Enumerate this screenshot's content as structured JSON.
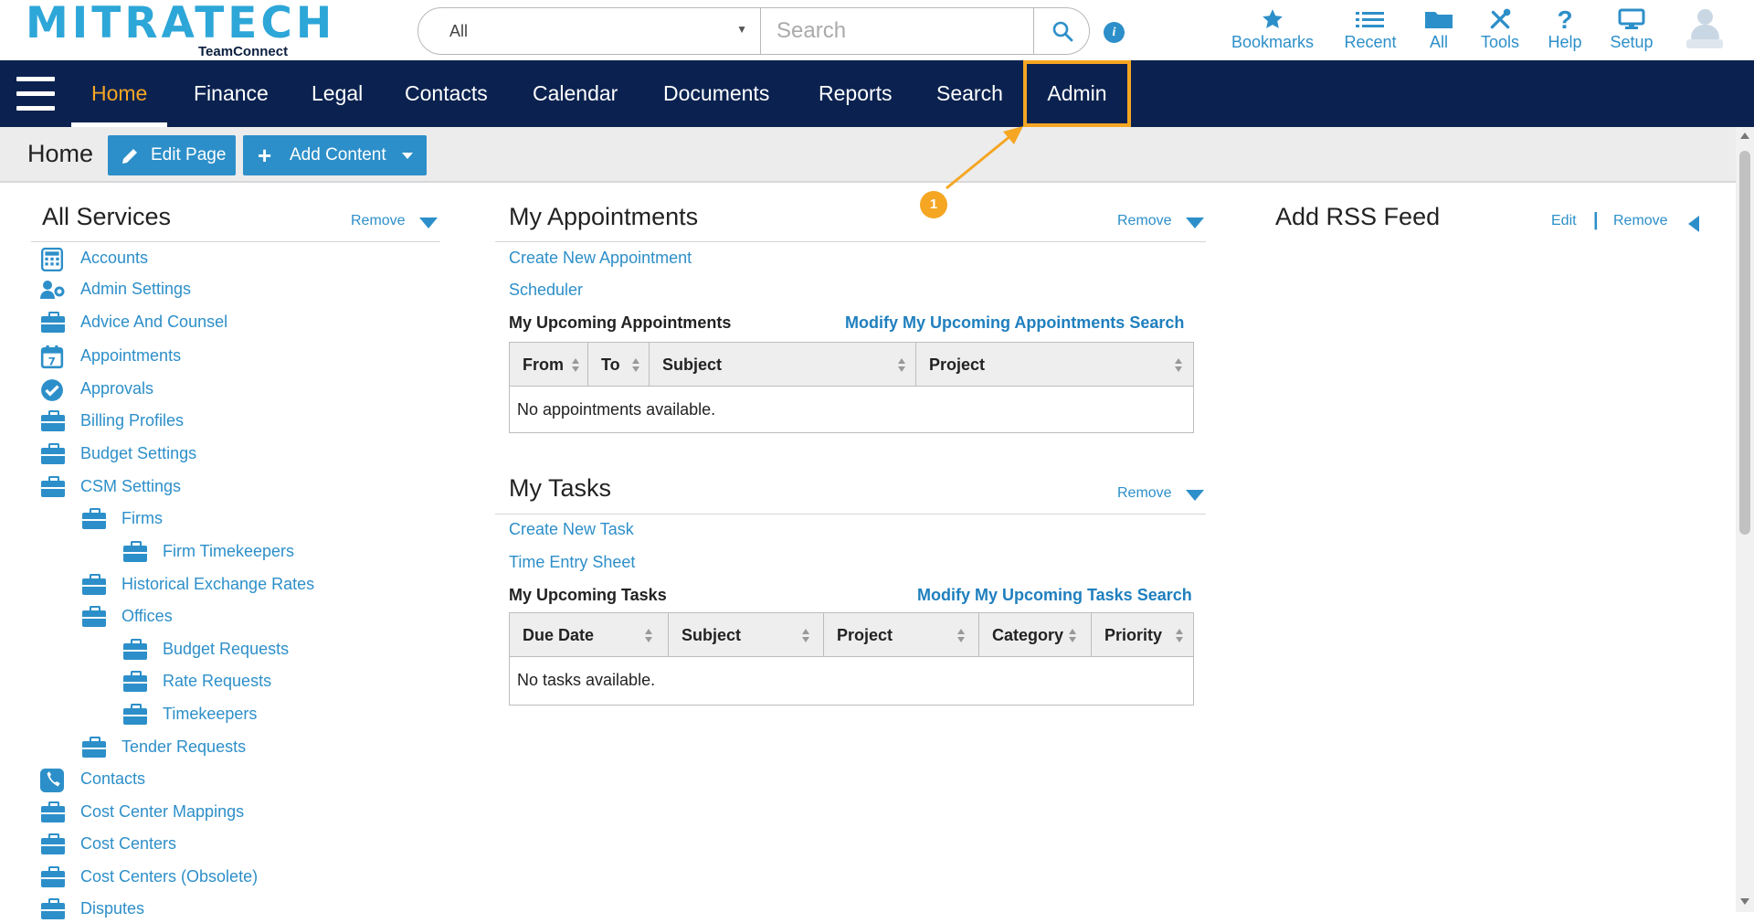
{
  "logo": {
    "main": "MITRATECH",
    "sub": "TeamConnect"
  },
  "search": {
    "scope": "All",
    "placeholder": "Search"
  },
  "toolbar": [
    {
      "label": "Bookmarks",
      "icon": "star-icon"
    },
    {
      "label": "Recent",
      "icon": "list-icon"
    },
    {
      "label": "All",
      "icon": "folder-icon"
    },
    {
      "label": "Tools",
      "icon": "tools-icon"
    },
    {
      "label": "Help",
      "icon": "help-icon"
    },
    {
      "label": "Setup",
      "icon": "monitor-icon"
    }
  ],
  "nav": [
    "Home",
    "Finance",
    "Legal",
    "Contacts",
    "Calendar",
    "Documents",
    "Reports",
    "Search",
    "Admin"
  ],
  "page": {
    "title": "Home",
    "edit_label": "Edit Page",
    "add_label": "Add Content"
  },
  "callout": "1",
  "services": {
    "title": "All Services",
    "remove": "Remove",
    "items": [
      {
        "label": "Accounts",
        "icon": "calculator-icon"
      },
      {
        "label": "Admin Settings",
        "icon": "admin-user-icon"
      },
      {
        "label": "Advice And Counsel",
        "icon": "briefcase-icon"
      },
      {
        "label": "Appointments",
        "icon": "calendar-icon"
      },
      {
        "label": "Approvals",
        "icon": "check-circle-icon"
      },
      {
        "label": "Billing Profiles",
        "icon": "briefcase-icon"
      },
      {
        "label": "Budget Settings",
        "icon": "briefcase-icon"
      },
      {
        "label": "CSM Settings",
        "icon": "briefcase-icon"
      },
      {
        "label": "Firms",
        "icon": "briefcase-icon"
      },
      {
        "label": "Firm Timekeepers",
        "icon": "briefcase-icon"
      },
      {
        "label": "Historical Exchange Rates",
        "icon": "briefcase-icon"
      },
      {
        "label": "Offices",
        "icon": "briefcase-icon"
      },
      {
        "label": "Budget Requests",
        "icon": "briefcase-icon"
      },
      {
        "label": "Rate Requests",
        "icon": "briefcase-icon"
      },
      {
        "label": "Timekeepers",
        "icon": "briefcase-icon"
      },
      {
        "label": "Tender Requests",
        "icon": "briefcase-icon"
      },
      {
        "label": "Contacts",
        "icon": "phone-icon"
      },
      {
        "label": "Cost Center Mappings",
        "icon": "briefcase-icon"
      },
      {
        "label": "Cost Centers",
        "icon": "briefcase-icon"
      },
      {
        "label": "Cost Centers (Obsolete)",
        "icon": "briefcase-icon"
      },
      {
        "label": "Disputes",
        "icon": "briefcase-icon"
      }
    ]
  },
  "appointments": {
    "title": "My Appointments",
    "remove": "Remove",
    "links": [
      "Create New Appointment",
      "Scheduler"
    ],
    "upcoming": "My Upcoming Appointments",
    "modify": "Modify My Upcoming Appointments Search",
    "columns": [
      "From",
      "To",
      "Subject",
      "Project"
    ],
    "empty": "No appointments available."
  },
  "tasks": {
    "title": "My Tasks",
    "remove": "Remove",
    "links": [
      "Create New Task",
      "Time Entry Sheet"
    ],
    "upcoming": "My Upcoming Tasks",
    "modify": "Modify My Upcoming Tasks Search",
    "columns": [
      "Due Date",
      "Subject",
      "Project",
      "Category",
      "Priority"
    ],
    "empty": "No tasks available."
  },
  "rss": {
    "title": "Add RSS Feed",
    "edit": "Edit",
    "separator": "|",
    "remove": "Remove"
  },
  "colors": {
    "navy": "#0b2250",
    "accent": "#2d8fc9",
    "highlight": "#f5a623"
  }
}
